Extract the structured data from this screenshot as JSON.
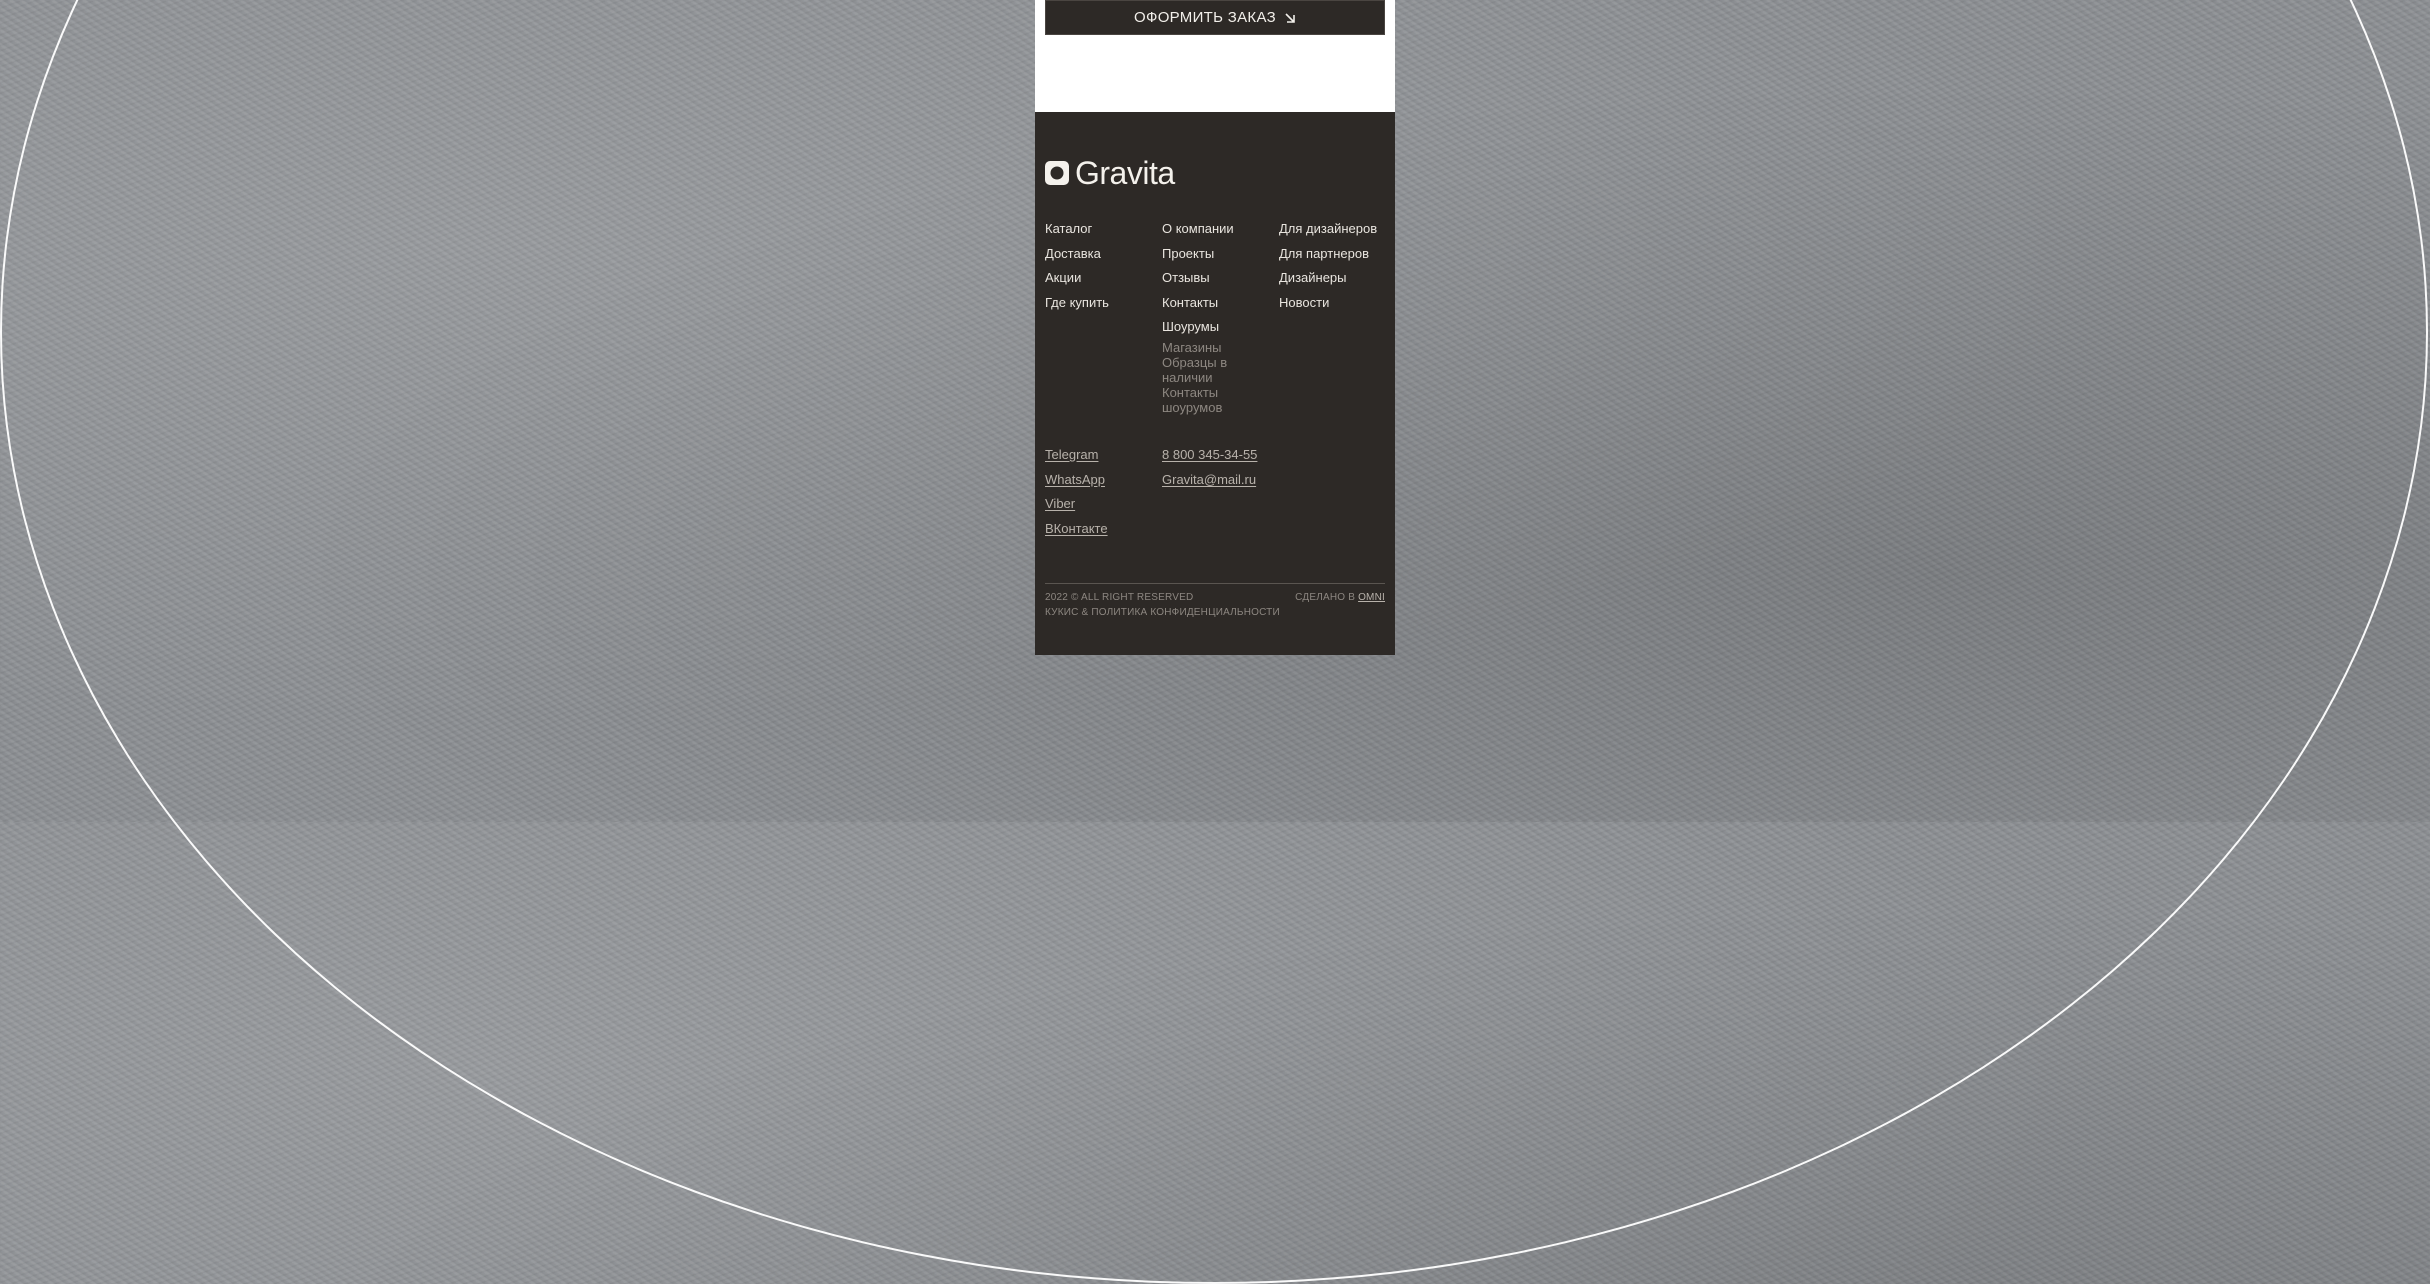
{
  "order_button": {
    "label": "ОФОРМИТЬ ЗАКАЗ",
    "icon": "arrow-down-right-icon"
  },
  "footer": {
    "logo_text": "Gravita",
    "col1": [
      "Каталог",
      "Доставка",
      "Акции",
      "Где купить"
    ],
    "col2": [
      "О компании",
      "Проекты",
      "Отзывы",
      "Контакты",
      "Шоурумы"
    ],
    "col2_sub": [
      "Магазины",
      "Образцы в наличии",
      "Контакты шоурумов"
    ],
    "col3": [
      "Для дизайнеров",
      "Для партнеров",
      "Дизайнеры",
      "Новости"
    ],
    "social": [
      "Telegram",
      "WhatsApp",
      "Viber",
      "ВКонтакте"
    ],
    "contacts": [
      "8 800 345-34-55",
      "Gravita@mail.ru"
    ],
    "copyright": "2022 © ALL RIGHT RESERVED",
    "privacy": "КУКИС & ПОЛИТИКА КОНФИДЕНЦИАЛЬНОСТИ",
    "made_by_prefix": "СДЕЛАНО В",
    "made_by_link": "OMNI"
  },
  "colors": {
    "footer_bg": "#2d2926",
    "text": "#e9e5df",
    "muted": "#8d8781",
    "page_bg": "#8c8f93"
  }
}
